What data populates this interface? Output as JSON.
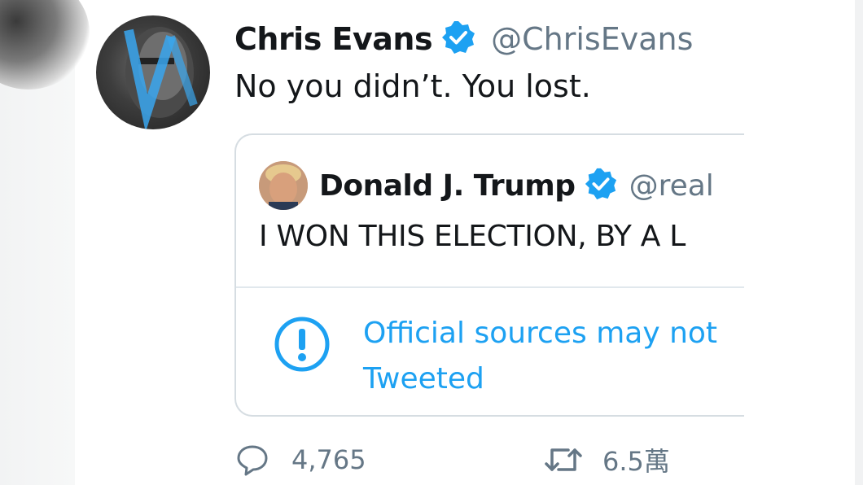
{
  "tweet": {
    "author_name": "Chris Evans",
    "author_handle": "@ChrisEvans",
    "text": "No you didn’t. You lost.",
    "avatar_icon": "profile-photo",
    "verified_icon": "verified-badge-icon"
  },
  "quoted_tweet": {
    "author_name": "Donald J. Trump",
    "author_handle": "@real",
    "text": "I WON THIS ELECTION, BY A L",
    "notice_icon": "exclamation-circle-icon",
    "notice_line1": "Official sources may not",
    "notice_line2": "Tweeted"
  },
  "actions": {
    "reply_count": "4,765",
    "retweet_count": "6.5萬"
  },
  "colors": {
    "accent": "#1da1f2",
    "text": "#14171a",
    "muted": "#657786",
    "border": "#d6dde2"
  }
}
